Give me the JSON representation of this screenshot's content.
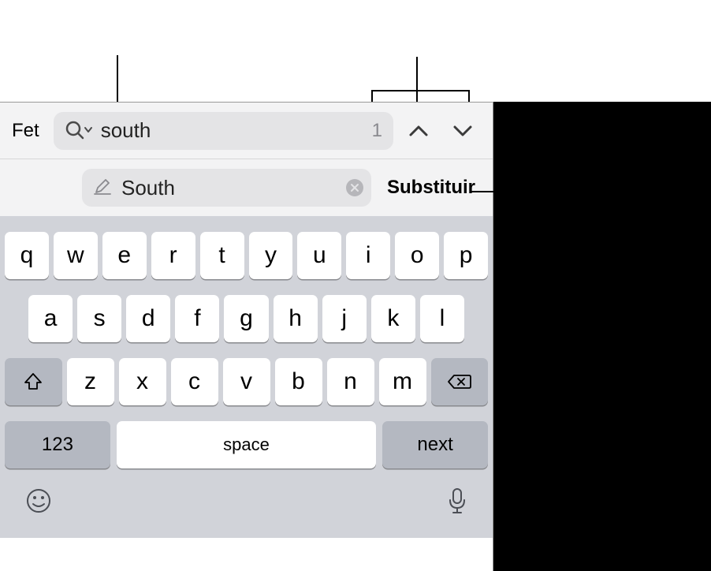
{
  "searchBar": {
    "doneLabel": "Fet",
    "searchText": "south",
    "matchCount": "1"
  },
  "replaceBar": {
    "replaceText": "South",
    "replaceButton": "Substituir"
  },
  "keyboard": {
    "row1": [
      "q",
      "w",
      "e",
      "r",
      "t",
      "y",
      "u",
      "i",
      "o",
      "p"
    ],
    "row2": [
      "a",
      "s",
      "d",
      "f",
      "g",
      "h",
      "j",
      "k",
      "l"
    ],
    "row3": [
      "z",
      "x",
      "c",
      "v",
      "b",
      "n",
      "m"
    ],
    "numKey": "123",
    "spaceKey": "space",
    "nextKey": "next"
  }
}
